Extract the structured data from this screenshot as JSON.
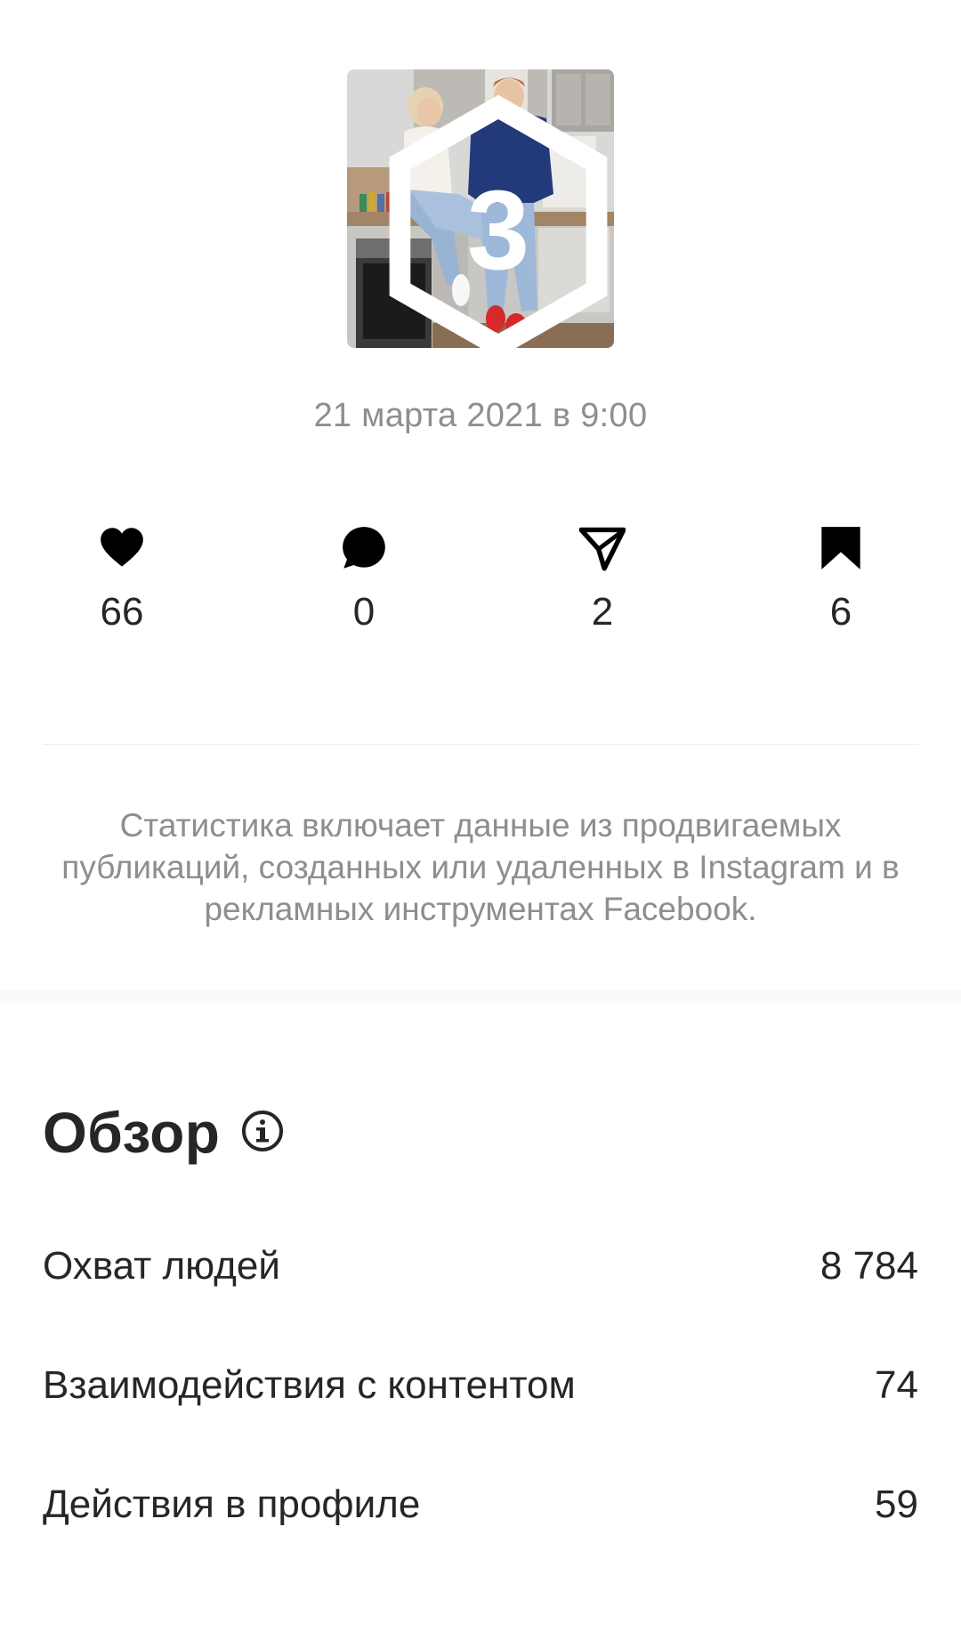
{
  "post": {
    "date": "21 марта 2021 в 9:00",
    "carousel_count": "3"
  },
  "metrics": {
    "likes": "66",
    "comments": "0",
    "shares": "2",
    "saves": "6"
  },
  "disclaimer": "Статистика включает данные из продвигаемых публикаций, созданных или удаленных в Instagram и в рекламных инструментах Facebook.",
  "overview": {
    "title": "Обзор",
    "rows": [
      {
        "label": "Охват людей",
        "value": "8 784"
      },
      {
        "label": "Взаимодействия с контентом",
        "value": "74"
      },
      {
        "label": "Действия в профиле",
        "value": "59"
      }
    ]
  },
  "icons": {
    "likes": "heart-icon",
    "comments": "comment-icon",
    "shares": "send-icon",
    "saves": "bookmark-icon",
    "info": "info-icon",
    "carousel": "carousel-icon"
  }
}
